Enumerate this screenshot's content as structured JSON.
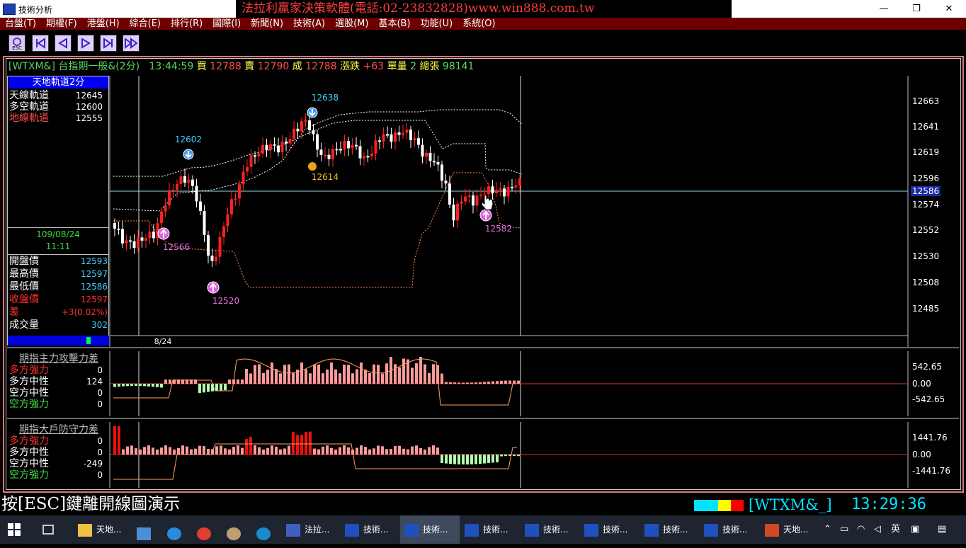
{
  "window": {
    "title": "技術分析",
    "ad_text": "法拉利贏家決策軟體(電話:02-23832828)www.win888.com.tw",
    "minimize": "—",
    "maximize": "❐",
    "close": "✕"
  },
  "menu": [
    "台盤(T)",
    "期權(F)",
    "港盤(H)",
    "綜合(E)",
    "排行(R)",
    "國際(I)",
    "新聞(N)",
    "技術(A)",
    "選股(M)",
    "基本(B)",
    "功能(U)",
    "系統(O)"
  ],
  "toolbar": {
    "esc_label": "ESC",
    "buttons": [
      "first-icon",
      "prev-icon",
      "next-icon",
      "last-icon",
      "fast-forward-icon"
    ]
  },
  "header": {
    "symbol": "[WTXM&]",
    "name": "台指期一般&(2分)",
    "time": "13:44:59",
    "buy_label": "買",
    "buy": "12788",
    "sell_label": "賣",
    "sell": "12790",
    "deal_label": "成",
    "deal": "12788",
    "change_label": "漲跌",
    "change": "+63",
    "vol_label": "單量",
    "vol": "2",
    "total_label": "總張",
    "total": "98141"
  },
  "indicator": {
    "title": "天地軌道2分",
    "rows": [
      {
        "label": "天線軌道",
        "value": "12645"
      },
      {
        "label": "多空軌道",
        "value": "12600"
      },
      {
        "label": "地線軌道",
        "value": "12555"
      }
    ]
  },
  "datetime": {
    "date": "109/08/24",
    "time": "11:11"
  },
  "quote": [
    {
      "label": "開盤價",
      "value": "12593"
    },
    {
      "label": "最高價",
      "value": "12597"
    },
    {
      "label": "最低價",
      "value": "12586"
    },
    {
      "label": "收盤價",
      "value": "12597"
    },
    {
      "label": "差",
      "value": "+3(0.02%)"
    },
    {
      "label": "成交量",
      "value": "302"
    }
  ],
  "price_axis": [
    "12663",
    "12641",
    "12619",
    "12596",
    "12586",
    "12574",
    "12552",
    "12530",
    "12508",
    "12485"
  ],
  "x_axis_label": "8/24",
  "markers": {
    "high1": "12602",
    "high2": "12638",
    "mid": "12614",
    "low1": "12566",
    "low2": "12520",
    "low3": "12582"
  },
  "panel2": {
    "title": "期指主力攻擊力差",
    "rows": [
      {
        "label": "多方強力",
        "value": "0"
      },
      {
        "label": "多方中性",
        "value": "124"
      },
      {
        "label": "空方中性",
        "value": "0"
      },
      {
        "label": "空方強力",
        "value": "0"
      }
    ],
    "axis": [
      "542.65",
      "0.00",
      "-542.65"
    ]
  },
  "panel3": {
    "title": "期指大戶防守力差",
    "rows": [
      {
        "label": "多方強力",
        "value": "0"
      },
      {
        "label": "多方中性",
        "value": "0"
      },
      {
        "label": "空方中性",
        "value": "-249"
      },
      {
        "label": "空方強力",
        "value": "0"
      }
    ],
    "axis": [
      "1441.76",
      "0.00",
      "-1441.76"
    ]
  },
  "footer": {
    "hint": "按[ESC]鍵離開線圖演示",
    "code": "[WTXM&_]",
    "time": "13:29:36"
  },
  "taskbar": {
    "apps": [
      "天地...",
      "法拉...",
      "技術...",
      "技術...",
      "技術...",
      "技術...",
      "技術...",
      "技術...",
      "技術...",
      "天地..."
    ],
    "ime": "英"
  },
  "colors": {
    "up": "#ff2020",
    "down": "#ffffff",
    "upper_band": "#ffffff",
    "lower_band": "#ff8c50",
    "price_line": "#9fd8e8"
  }
}
